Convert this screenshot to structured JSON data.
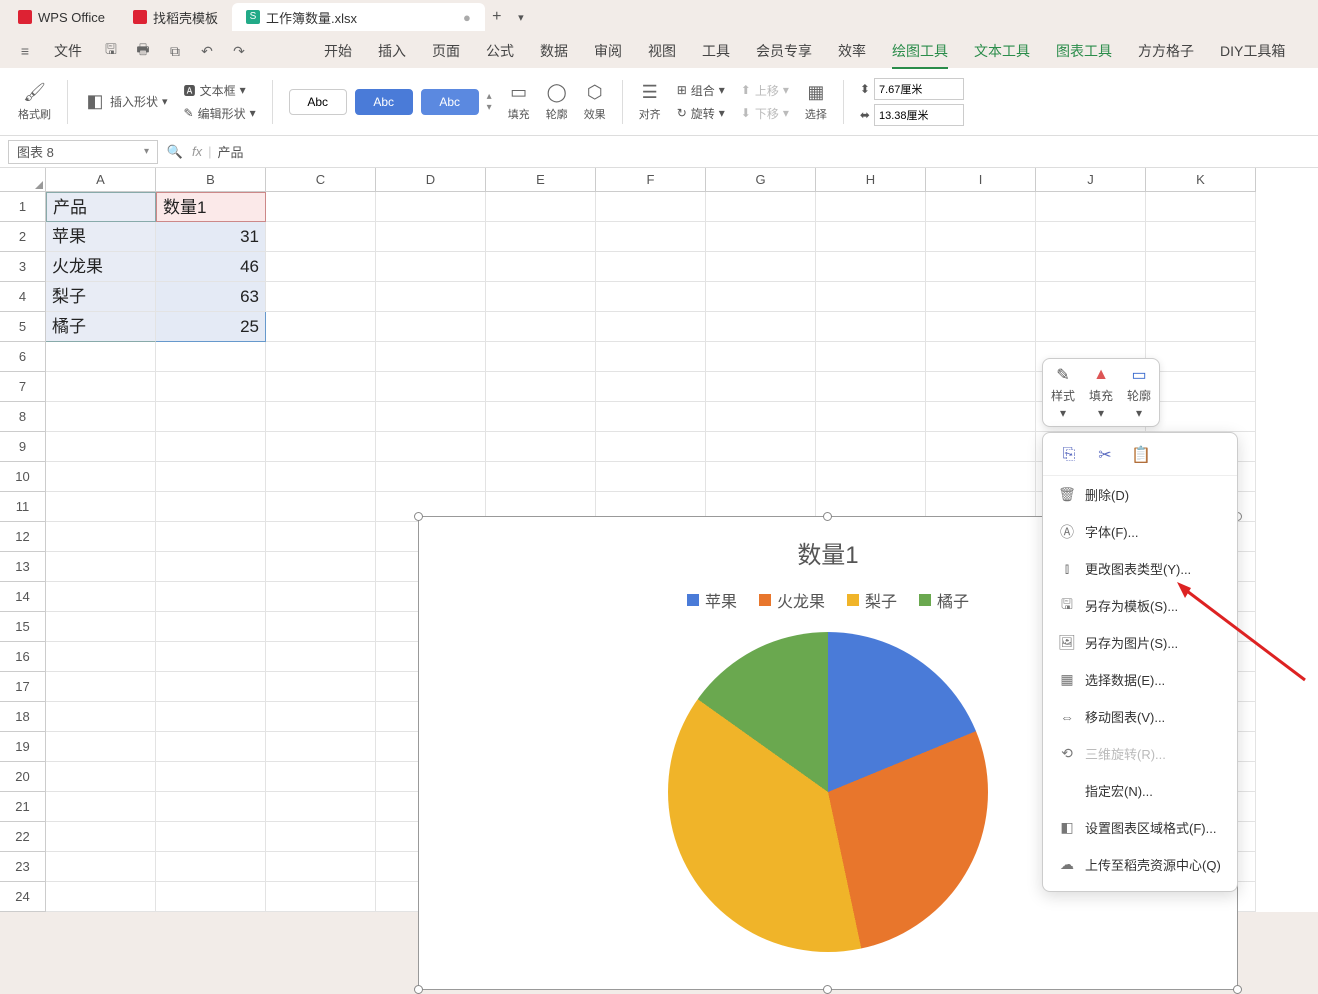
{
  "tabs": {
    "wps": "WPS Office",
    "template": "找稻壳模板",
    "file": "工作簿数量.xlsx"
  },
  "menubar": {
    "file": "文件",
    "items": [
      "开始",
      "插入",
      "页面",
      "公式",
      "数据",
      "审阅",
      "视图",
      "工具",
      "会员专享",
      "效率",
      "绘图工具",
      "文本工具",
      "图表工具",
      "方方格子",
      "DIY工具箱"
    ]
  },
  "ribbon": {
    "format_painter": "格式刷",
    "insert_shape": "插入形状",
    "textbox": "文本框",
    "edit_shape": "编辑形状",
    "abc": "Abc",
    "fill": "填充",
    "outline": "轮廓",
    "effect": "效果",
    "align": "对齐",
    "group": "组合",
    "rotate": "旋转",
    "up": "上移",
    "down": "下移",
    "select": "选择",
    "width": "7.67厘米",
    "height": "13.38厘米"
  },
  "namebox": "图表 8",
  "fx_value": "产品",
  "headers": [
    "A",
    "B",
    "C",
    "D",
    "E",
    "F",
    "G",
    "H",
    "I",
    "J",
    "K"
  ],
  "rows": [
    {
      "n": "1",
      "a": "产品",
      "b": "数量1"
    },
    {
      "n": "2",
      "a": "苹果",
      "b": "31"
    },
    {
      "n": "3",
      "a": "火龙果",
      "b": "46"
    },
    {
      "n": "4",
      "a": "梨子",
      "b": "63"
    },
    {
      "n": "5",
      "a": "橘子",
      "b": "25"
    }
  ],
  "chart_data": {
    "type": "pie",
    "title": "数量1",
    "categories": [
      "苹果",
      "火龙果",
      "梨子",
      "橘子"
    ],
    "values": [
      31,
      46,
      63,
      25
    ],
    "colors": [
      "#4a7bd8",
      "#e8762c",
      "#f0b429",
      "#6aa84f"
    ]
  },
  "mini": {
    "style": "样式",
    "fill": "填充",
    "outline": "轮廓"
  },
  "ctx": {
    "delete": "删除(D)",
    "font": "字体(F)...",
    "change_type": "更改图表类型(Y)...",
    "save_template": "另存为模板(S)...",
    "save_image": "另存为图片(S)...",
    "select_data": "选择数据(E)...",
    "move_chart": "移动图表(V)...",
    "rotate3d": "三维旋转(R)...",
    "macro": "指定宏(N)...",
    "format_area": "设置图表区域格式(F)...",
    "upload": "上传至稻壳资源中心(Q)"
  }
}
